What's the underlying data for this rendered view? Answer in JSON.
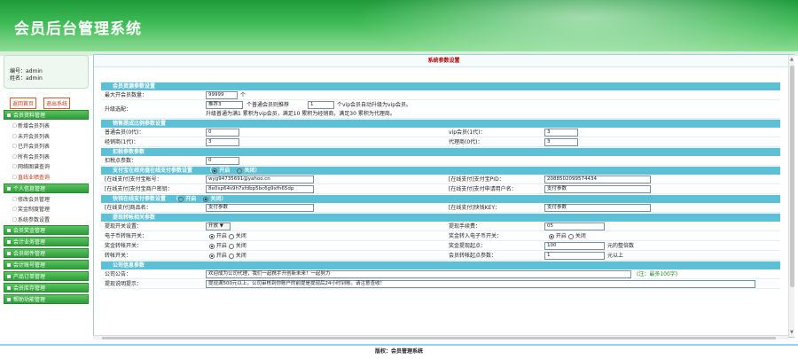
{
  "app_title": "会员后台管理系统",
  "user": {
    "id_line": "编号：admin",
    "name_line": "姓名：admin"
  },
  "buttons": {
    "home": "返回首页",
    "logout": "退出系统"
  },
  "nav": {
    "groups": [
      {
        "label": "会员资料管理",
        "items": [
          "新增会员列表",
          "未开会员列表",
          "已开会员列表",
          "所有会员列表",
          "网络图谱查询",
          "直线业绩查询"
        ]
      },
      {
        "label": "个人信息管理",
        "items": [
          "修改会员管理",
          "奖金制度管理",
          "系统参数设置"
        ]
      },
      {
        "label": "会员奖金管理"
      },
      {
        "label": "会计业务管理"
      },
      {
        "label": "会员邮件管理"
      },
      {
        "label": "会计账号管理"
      },
      {
        "label": "产品订单管理"
      },
      {
        "label": "会员库存管理"
      },
      {
        "label": "帮助功能管理"
      }
    ]
  },
  "page_title": "系统参数设置",
  "sections": {
    "s1": "会员资源参数设置",
    "s2": "销售提成比例参数设置",
    "s3": "扣税参数参数",
    "s4": "支付宝在线充值在线支付参数设置",
    "s5": "快钱在线支付参数设置",
    "s6": "提现转帐相关参数",
    "s7": "公司信息参数"
  },
  "fields": {
    "max_open": {
      "label": "最大开会员数量：",
      "value": "99999",
      "unit": "个"
    },
    "upgrade": {
      "label": "升级选配：",
      "line1_a": "推荐3",
      "line1_b": "个普通会员则推荐",
      "line1_c": "1",
      "line1_d": "个vip会员自动升级为vip会员。",
      "line2": "升级普通为满1      累积为vip会员，满足10      累积为经销商，满足30      累积为代理商。"
    },
    "normal_vip": {
      "label": "普通会员(0代)：",
      "value": "0"
    },
    "vip": {
      "label": "vip会员(1代)：",
      "value": "3"
    },
    "dealer": {
      "label": "经销商(1代)：",
      "value": "3"
    },
    "agent": {
      "label": "代理商(0代)：",
      "value": "3"
    },
    "tax": {
      "label": "扣税点参数：",
      "value": "0"
    },
    "alipay_on": "开启",
    "alipay_off": "关闭",
    "alipay_acct": {
      "label": "[在线支付]支付宝帐号：",
      "value": "wyg94735691@yahoo.cn"
    },
    "alipay_pid": {
      "label": "[在线支付]支付宝PID：",
      "value": "2088502099574434"
    },
    "alipay_key": {
      "label": "[在线支付]支付宝商户密钥：",
      "value": "8e0xp64s9h7xfdbp5bc6g9xfh65dp"
    },
    "alipay_name": {
      "label": "[在线支付]支付申请用户名：",
      "value": "支付参数"
    },
    "kq_on": "开启",
    "kq_off": "关闭",
    "kq_acct": {
      "label": "[在线支付]商品名：",
      "value": "支付参数"
    },
    "kq_key": {
      "label": "[在线支付]快钱KEY：",
      "value": "支付参数"
    },
    "withdraw_switch": {
      "label": "提现开关设置：",
      "value": "开放 ▼"
    },
    "withdraw_fee": {
      "label": "提现手续费：",
      "value": "05"
    },
    "ewallet": {
      "label": "电子币转账开关：",
      "on": "开启",
      "off": "关闭"
    },
    "bonus_to_ewallet": {
      "label": "奖金转入电子币开关：",
      "on": "开启",
      "off": "关闭"
    },
    "bonus_switch": {
      "label": "奖金转帐开关：",
      "on": "开启",
      "off": "关闭"
    },
    "min_withdraw": {
      "label": "奖金提现起点：",
      "value": "100",
      "unit": "元的整倍数"
    },
    "transfer_switch": {
      "label": "转帐开关：",
      "on": "开启",
      "off": "关闭"
    },
    "min_rebuy": {
      "label": "会员转帐起点参数：",
      "value": "1",
      "unit": "元以上"
    },
    "company_notice": {
      "label": "公司公告：",
      "value": "欢迎成为公司代理，我们一起携手开创新未来！一起努力",
      "hint": "(注：最多100字)"
    },
    "withdraw_tip": {
      "label": "提现说明提示：",
      "value": "提现满500元以上，公司审核到你账户的前提是提现后24小时到账。请注意查收！"
    }
  },
  "footer": "版权：会员管理系统"
}
